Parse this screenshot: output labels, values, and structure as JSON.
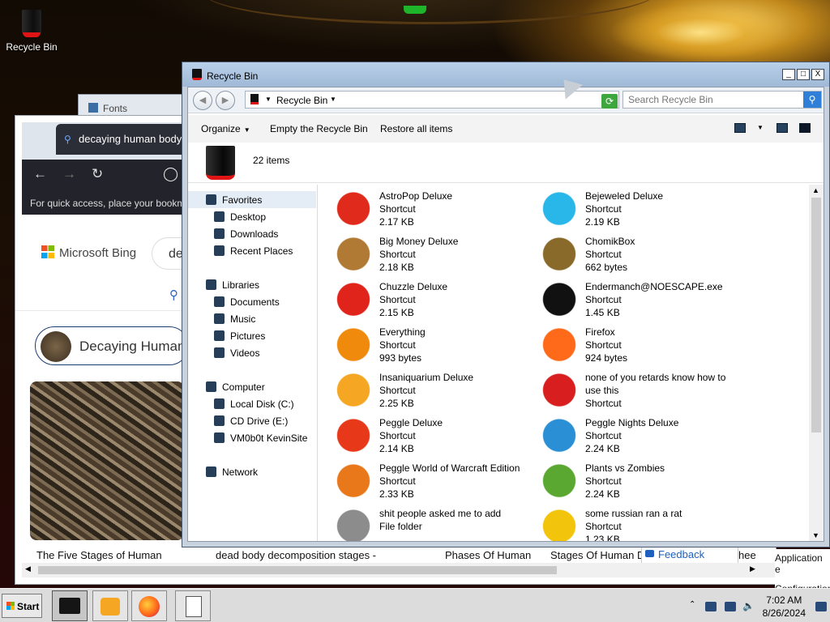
{
  "desktop": {
    "icons": [
      {
        "label": "Recycle Bin",
        "icon": "recycle-bin-icon"
      }
    ]
  },
  "fonts_window": {
    "title": "Fonts"
  },
  "browser": {
    "tab_title": "decaying human body -",
    "bookmarks_hint": "For quick access, place your bookm",
    "brand": "Microsoft Bing",
    "search_text": "de",
    "chip_label": "Decaying Human",
    "captions": [
      "The Five Stages of Human",
      "dead body decomposition stages -",
      "Phases Of Human",
      "Stages Of Human D"
    ],
    "feedback_label": "Feedback",
    "partial_text": "hee",
    "right_edge_lines": [
      "Application e",
      "Configuration"
    ]
  },
  "explorer": {
    "title": "Recycle Bin",
    "address": "Recycle Bin",
    "search_placeholder": "Search Recycle Bin",
    "toolbar": {
      "organize": "Organize",
      "empty": "Empty the Recycle Bin",
      "restore": "Restore all items"
    },
    "item_count": "22 items",
    "window_buttons": {
      "minimize": "_",
      "maximize": "□",
      "close": "X"
    },
    "sidebar": [
      {
        "label": "Favorites",
        "type": "group",
        "selected": true
      },
      {
        "label": "Desktop",
        "type": "child"
      },
      {
        "label": "Downloads",
        "type": "child"
      },
      {
        "label": "Recent Places",
        "type": "child"
      },
      {
        "label": "Libraries",
        "type": "group"
      },
      {
        "label": "Documents",
        "type": "child"
      },
      {
        "label": "Music",
        "type": "child"
      },
      {
        "label": "Pictures",
        "type": "child"
      },
      {
        "label": "Videos",
        "type": "child"
      },
      {
        "label": "Computer",
        "type": "group"
      },
      {
        "label": "Local Disk (C:)",
        "type": "child"
      },
      {
        "label": "CD Drive (E:)",
        "type": "child"
      },
      {
        "label": "VM0b0t KevinSite",
        "type": "child"
      },
      {
        "label": "Network",
        "type": "group"
      }
    ],
    "items": [
      {
        "name": "AstroPop Deluxe",
        "type": "Shortcut",
        "size": "2.17 KB",
        "icon": "astropop-icon",
        "color": "#e02b1c"
      },
      {
        "name": "Bejeweled Deluxe",
        "type": "Shortcut",
        "size": "2.19 KB",
        "icon": "diamond-icon",
        "color": "#29b6e8"
      },
      {
        "name": "Big Money Deluxe",
        "type": "Shortcut",
        "size": "2.18 KB",
        "icon": "money-bag-icon",
        "color": "#b07a34"
      },
      {
        "name": "ChomikBox",
        "type": "Shortcut",
        "size": "662 bytes",
        "icon": "hamster-icon",
        "color": "#8a6a2a"
      },
      {
        "name": "Chuzzle Deluxe",
        "type": "Shortcut",
        "size": "2.15 KB",
        "icon": "chuzzle-icon",
        "color": "#e0241b"
      },
      {
        "name": "Endermanch@NOESCAPE.exe",
        "type": "Shortcut",
        "size": "1.45 KB",
        "icon": "terminal-icon",
        "color": "#111111"
      },
      {
        "name": "Everything",
        "type": "Shortcut",
        "size": "993 bytes",
        "icon": "magnifier-icon",
        "color": "#f08a0c"
      },
      {
        "name": "Firefox",
        "type": "Shortcut",
        "size": "924 bytes",
        "icon": "firefox-icon",
        "color": "#ff6a1a"
      },
      {
        "name": "Insaniquarium Deluxe",
        "type": "Shortcut",
        "size": "2.25 KB",
        "icon": "goldfish-icon",
        "color": "#f5a623"
      },
      {
        "name": "none of you retards know how to use this",
        "type": "Shortcut",
        "size": "",
        "icon": "dragon-icon",
        "color": "#d81e1e"
      },
      {
        "name": "Peggle Deluxe",
        "type": "Shortcut",
        "size": "2.14 KB",
        "icon": "peggle-icon",
        "color": "#e8381a"
      },
      {
        "name": "Peggle Nights Deluxe",
        "type": "Shortcut",
        "size": "2.24 KB",
        "icon": "peggle-nights-icon",
        "color": "#2a8fd4"
      },
      {
        "name": "Peggle World of Warcraft Edition",
        "type": "Shortcut",
        "size": "2.33 KB",
        "icon": "peggle-wow-icon",
        "color": "#e8781a"
      },
      {
        "name": "Plants vs Zombies",
        "type": "Shortcut",
        "size": "2.24 KB",
        "icon": "plant-icon",
        "color": "#5aa832"
      },
      {
        "name": "shit people asked me to add",
        "type": "File folder",
        "size": "",
        "icon": "folder-icon",
        "color": "#8c8c8c"
      },
      {
        "name": "some russian ran a rat",
        "type": "Shortcut",
        "size": "1.23 KB",
        "icon": "de-icon",
        "color": "#f2c40c"
      }
    ]
  },
  "taskbar": {
    "start_label": "Start",
    "time": "7:02 AM",
    "date": "8/26/2024"
  }
}
